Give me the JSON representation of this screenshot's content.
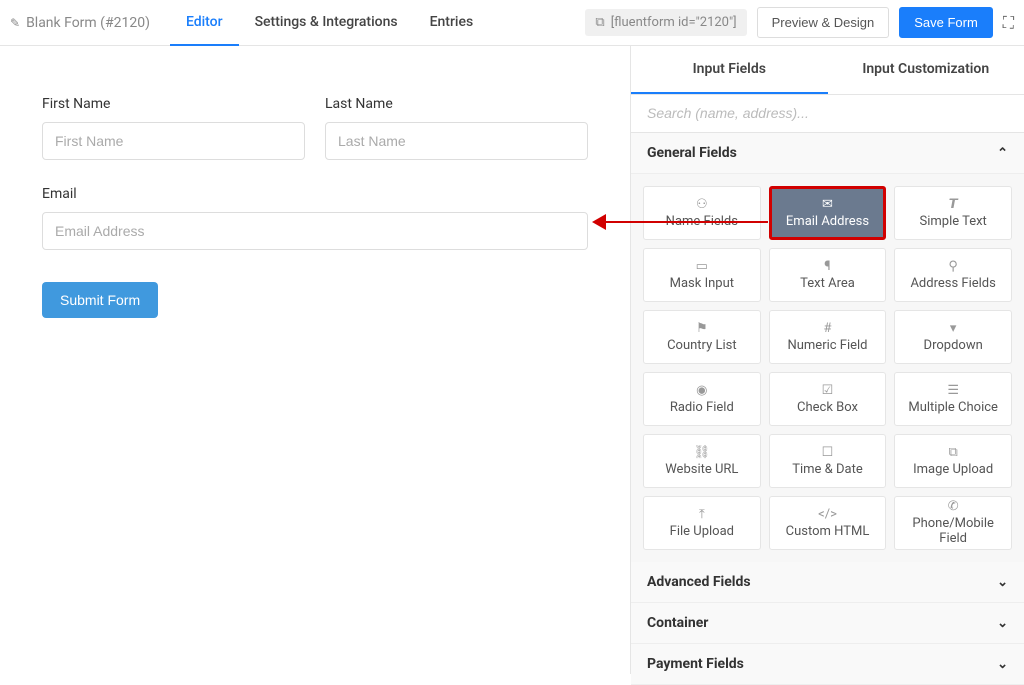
{
  "header": {
    "formName": "Blank Form (#2120)",
    "tabs": [
      "Editor",
      "Settings & Integrations",
      "Entries"
    ],
    "activeTab": 0,
    "shortcode": "[fluentform id=\"2120\"]",
    "previewButton": "Preview & Design",
    "saveButton": "Save Form"
  },
  "formFields": {
    "firstName": {
      "label": "First Name",
      "placeholder": "First Name"
    },
    "lastName": {
      "label": "Last Name",
      "placeholder": "Last Name"
    },
    "email": {
      "label": "Email",
      "placeholder": "Email Address"
    },
    "submit": "Submit Form"
  },
  "sidebar": {
    "tabs": [
      "Input Fields",
      "Input Customization"
    ],
    "activeTab": 0,
    "searchPlaceholder": "Search (name, address)...",
    "sections": {
      "general": {
        "title": "General Fields",
        "fields": [
          {
            "icon": "user",
            "label": "Name Fields"
          },
          {
            "icon": "mail",
            "label": "Email Address",
            "highlighted": true
          },
          {
            "icon": "text",
            "label": "Simple Text"
          },
          {
            "icon": "mask",
            "label": "Mask Input"
          },
          {
            "icon": "textarea",
            "label": "Text Area"
          },
          {
            "icon": "pin",
            "label": "Address Fields"
          },
          {
            "icon": "flag",
            "label": "Country List"
          },
          {
            "icon": "hash",
            "label": "Numeric Field"
          },
          {
            "icon": "dropdown",
            "label": "Dropdown"
          },
          {
            "icon": "radio",
            "label": "Radio Field"
          },
          {
            "icon": "check",
            "label": "Check Box"
          },
          {
            "icon": "list",
            "label": "Multiple Choice"
          },
          {
            "icon": "link",
            "label": "Website URL"
          },
          {
            "icon": "calendar",
            "label": "Time & Date"
          },
          {
            "icon": "image",
            "label": "Image Upload"
          },
          {
            "icon": "upload",
            "label": "File Upload"
          },
          {
            "icon": "code",
            "label": "Custom HTML"
          },
          {
            "icon": "phone",
            "label": "Phone/Mobile Field"
          }
        ]
      },
      "advanced": {
        "title": "Advanced Fields"
      },
      "container": {
        "title": "Container"
      },
      "payment": {
        "title": "Payment Fields"
      }
    }
  }
}
